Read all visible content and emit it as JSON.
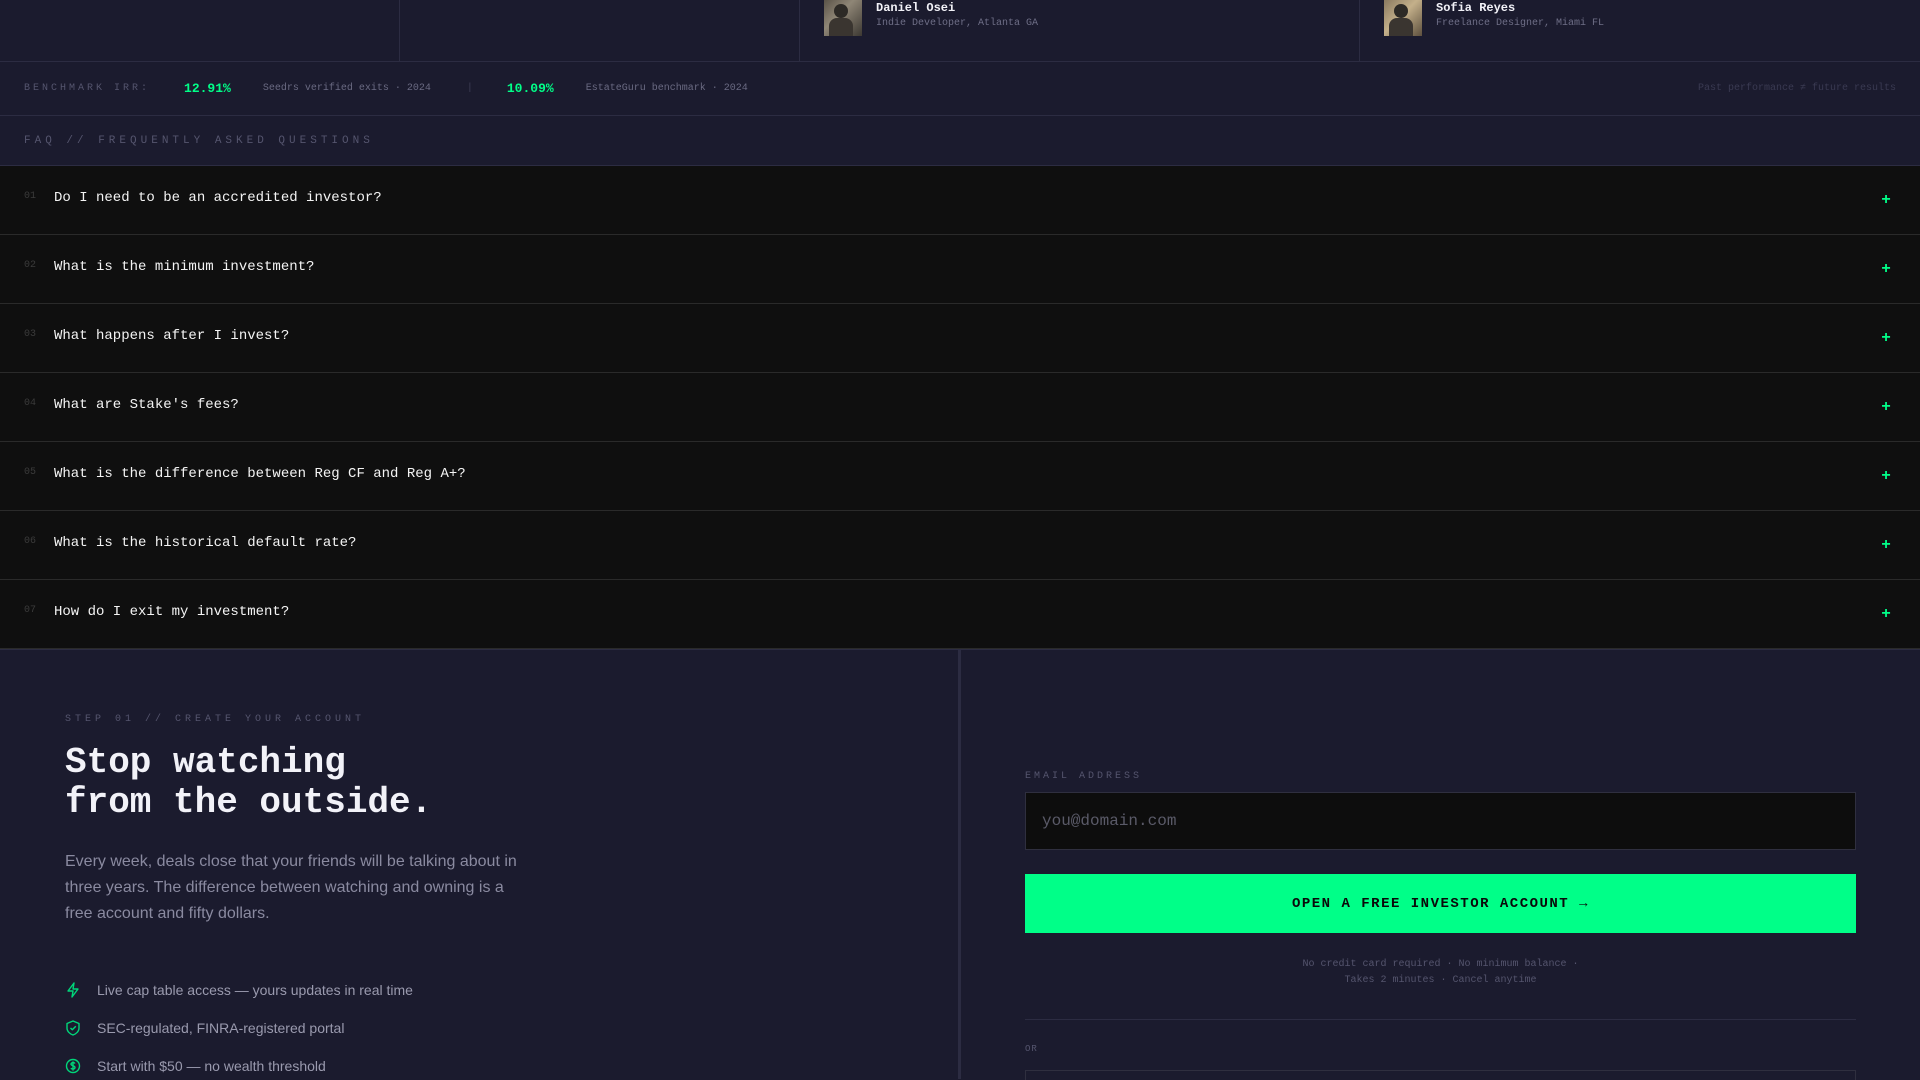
{
  "testimonials": [
    {
      "name": "Daniel Osei",
      "role": "Indie Developer, Atlanta GA"
    },
    {
      "name": "Sofia Reyes",
      "role": "Freelance Designer, Miami FL"
    }
  ],
  "benchmark": {
    "label": "BENCHMARK IRR:",
    "items": [
      {
        "value": "12.91%",
        "source": "Seedrs verified exits · 2024"
      },
      {
        "value": "10.09%",
        "source": "EstateGuru benchmark · 2024"
      }
    ],
    "separator": "|",
    "note": "Past performance ≠ future results"
  },
  "faq": {
    "heading": "FAQ // FREQUENTLY ASKED QUESTIONS",
    "items": [
      {
        "num": "01",
        "question": "Do I need to be an accredited investor?"
      },
      {
        "num": "02",
        "question": "What is the minimum investment?"
      },
      {
        "num": "03",
        "question": "What happens after I invest?"
      },
      {
        "num": "04",
        "question": "What are Stake's fees?"
      },
      {
        "num": "05",
        "question": "What is the difference between Reg CF and Reg A+?"
      },
      {
        "num": "06",
        "question": "What is the historical default rate?"
      },
      {
        "num": "07",
        "question": "How do I exit my investment?"
      }
    ],
    "expand_symbol": "+"
  },
  "cta": {
    "step_label": "STEP 01 // CREATE YOUR ACCOUNT",
    "headline": "Stop watching\nfrom the outside.",
    "body": "Every week, deals close that your friends will be talking about in three years. The difference between watching and owning is a free account and fifty dollars.",
    "benefits": [
      {
        "icon": "lightning-icon",
        "text": "Live cap table access — yours updates in real time"
      },
      {
        "icon": "shield-check-icon",
        "text": "SEC-regulated, FINRA-registered portal"
      },
      {
        "icon": "dollar-circle-icon",
        "text": "Start with $50 — no wealth threshold"
      }
    ],
    "email_label": "EMAIL ADDRESS",
    "email_placeholder": "you@domain.com",
    "email_value": "",
    "button_label": "OPEN A FREE INVESTOR ACCOUNT →",
    "fineprint_line1": "No credit card required · No minimum balance ·",
    "fineprint_line2": "Takes 2 minutes · Cancel anytime",
    "or_label": "OR"
  },
  "colors": {
    "accent": "#00ff88",
    "background": "#1b1b2e",
    "faq_background": "#0f0f0f"
  }
}
